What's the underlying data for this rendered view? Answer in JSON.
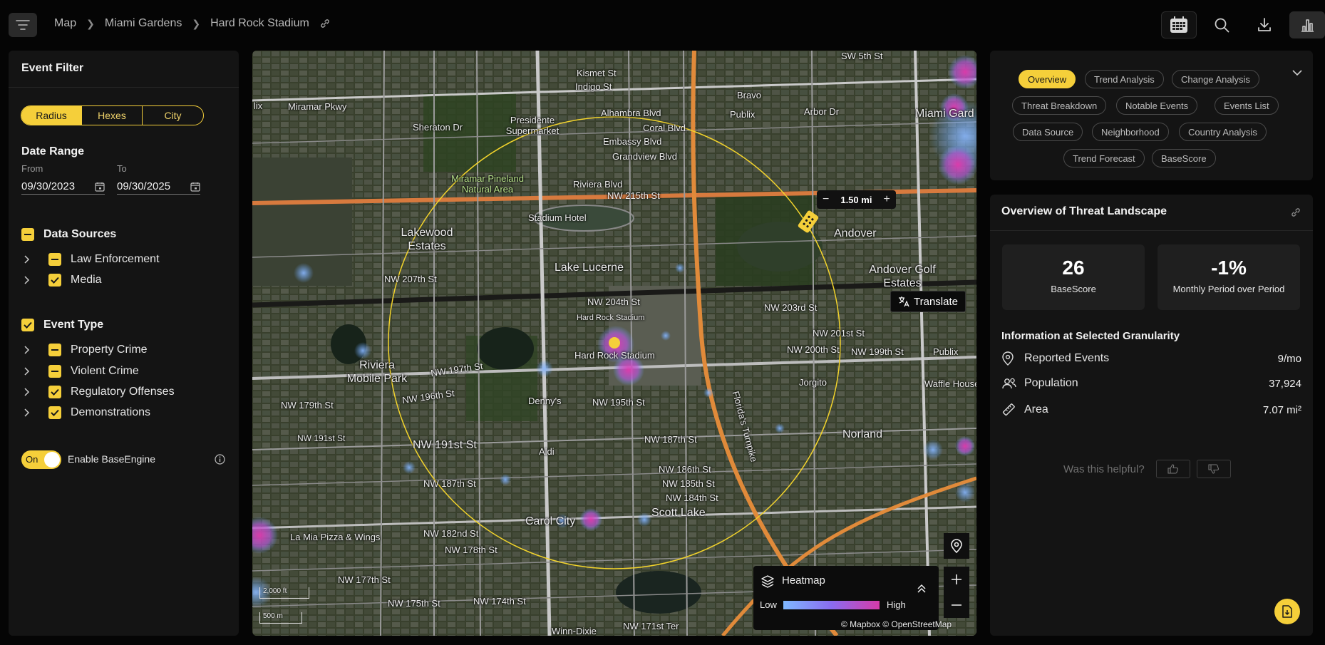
{
  "breadcrumb": {
    "items": [
      "Map",
      "Miami Gardens",
      "Hard Rock Stadium"
    ]
  },
  "icons": {
    "menu": "menu-icon",
    "link": "link-icon",
    "calendar_view": "calendar-grid-icon",
    "search": "search-icon",
    "download": "download-icon",
    "chart": "bar-chart-icon"
  },
  "event_filter": {
    "title": "Event Filter",
    "modes": [
      {
        "label": "Radius",
        "active": true
      },
      {
        "label": "Hexes",
        "active": false
      },
      {
        "label": "City",
        "active": false
      }
    ],
    "date_range": {
      "title": "Date Range",
      "from_label": "From",
      "from_value": "09/30/2023",
      "to_label": "To",
      "to_value": "09/30/2025"
    },
    "data_sources": {
      "title": "Data Sources",
      "state": "partial",
      "items": [
        {
          "label": "Law Enforcement",
          "state": "partial"
        },
        {
          "label": "Media",
          "state": "checked"
        }
      ]
    },
    "event_type": {
      "title": "Event Type",
      "state": "checked",
      "items": [
        {
          "label": "Property Crime",
          "state": "partial"
        },
        {
          "label": "Violent Crime",
          "state": "partial"
        },
        {
          "label": "Regulatory Offenses",
          "state": "checked"
        },
        {
          "label": "Demonstrations",
          "state": "checked"
        }
      ]
    },
    "base_engine": {
      "toggle_label": "On",
      "label": "Enable BaseEngine",
      "enabled": true
    }
  },
  "map": {
    "radius_value": "1.50 mi",
    "translate_label": "Translate",
    "heatmap": {
      "title": "Heatmap",
      "low": "Low",
      "high": "High"
    },
    "attribution": "© Mapbox  © OpenStreetMap",
    "scale": {
      "imperial": "2,000 ft",
      "metric": "500 m"
    },
    "labels": {
      "miramar_pkwy": "Miramar Pkwy",
      "sheraton": "Sheraton Dr",
      "presidente": "Presidente Supermarket",
      "indigo": "Indigo St",
      "kismet": "Kismet St",
      "alhambra": "Alhambra Blvd",
      "coral": "Coral Blvd",
      "embassy": "Embassy Blvd",
      "grandview": "Grandview Blvd",
      "bravo": "Bravo",
      "publix": "Publix",
      "arbor": "Arbor Dr",
      "miami_gard": "Miami Gard",
      "pineland": "Miramar Pineland Natural Area",
      "riviera": "Riviera Blvd",
      "nw215": "NW 215th St",
      "stadium_hotel": "Stadium Hotel",
      "lakewood": "Lakewood Estates",
      "andover": "Andover",
      "andover_golf": "Andover Golf Estates",
      "lake_lucerne": "Lake Lucerne",
      "nw207": "NW 207th St",
      "nw204": "NW 204th St",
      "nw203rd": "NW 203rd St",
      "nw201": "NW 201st St",
      "nw200": "NW 200th St",
      "nw199": "NW 199th St",
      "publix2": "Publix",
      "hrs1": "Hard Rock Stadium",
      "hrs2": "Hard Rock Stadium",
      "riviera_mp": "Riviera Mobile Park",
      "nw197": "NW 197th St",
      "nw196": "NW 196th St",
      "dennys": "Denny's",
      "nw195": "NW 195th St",
      "jorgito": "Jorgito",
      "waffle": "Waffle House",
      "norland": "Norland",
      "nw191": "NW 191st St",
      "nw191b": "NW 191st St",
      "aldi": "Aldi",
      "nw187": "NW 187th St",
      "nw186": "NW 186th St",
      "nw185": "NW 185th St",
      "nw184": "NW 184th St",
      "carol_city": "Carol City",
      "scott_lake": "Scott Lake",
      "la_mia": "La Mia Pizza & Wings",
      "nw182": "NW 182nd St",
      "nw178": "NW 178th St",
      "nw177": "NW 177th St",
      "nw175": "NW 175th St",
      "nw174": "NW 174th St",
      "nw171": "NW 171st Ter",
      "winn_dixie": "Winn-Dixie",
      "florida_tpk": "Florida's Turnpike",
      "sw5": "SW 5th St",
      "nw179": "NW 179th St"
    }
  },
  "tabs": [
    {
      "label": "Overview",
      "active": true
    },
    {
      "label": "Trend Analysis"
    },
    {
      "label": "Change Analysis"
    },
    {
      "label": "Threat Breakdown"
    },
    {
      "label": "Notable Events"
    },
    {
      "label": "Events List"
    },
    {
      "label": "Data Source"
    },
    {
      "label": "Neighborhood"
    },
    {
      "label": "Country Analysis"
    },
    {
      "label": "Trend Forecast"
    },
    {
      "label": "BaseScore"
    }
  ],
  "overview": {
    "title": "Overview of Threat Landscape",
    "cards": [
      {
        "value": "26",
        "label": "BaseScore"
      },
      {
        "value": "-1%",
        "label": "Monthly Period over Period"
      }
    ],
    "granularity_title": "Information at Selected Granularity",
    "rows": [
      {
        "label": "Reported Events",
        "value": "9/mo",
        "icon": "pin-icon"
      },
      {
        "label": "Population",
        "value": "37,924",
        "icon": "people-icon"
      },
      {
        "label": "Area",
        "value": "7.07 mi²",
        "icon": "ruler-icon"
      }
    ],
    "helpful": "Was this helpful?"
  },
  "colors": {
    "accent": "#f5cf3a",
    "panel": "#141414",
    "background": "#050505",
    "heat_low": "#7fb8ff",
    "heat_high": "#d63ba8"
  }
}
